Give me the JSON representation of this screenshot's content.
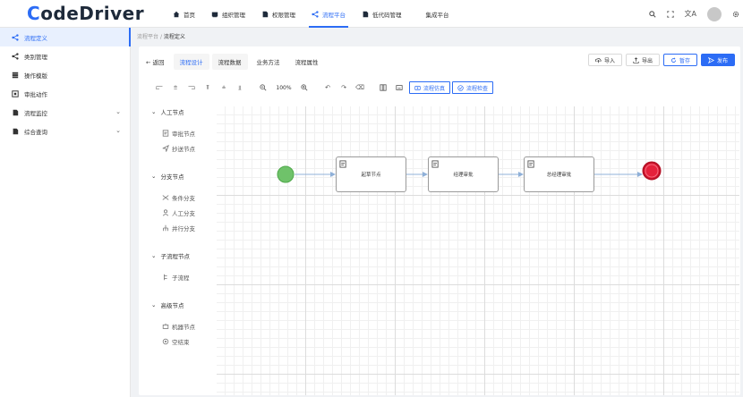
{
  "app": {
    "logo_first": "C",
    "logo_rest": "odeDriver"
  },
  "topnav": [
    {
      "label": "首页",
      "icon": "home-icon"
    },
    {
      "label": "组织管理",
      "icon": "org-icon"
    },
    {
      "label": "权限管理",
      "icon": "permission-icon"
    },
    {
      "label": "流程平台",
      "icon": "workflow-icon",
      "active": true
    },
    {
      "label": "低代码管理",
      "icon": "lowcode-icon"
    },
    {
      "label": "集成平台",
      "icon": ""
    }
  ],
  "sidebar": {
    "items": [
      {
        "label": "流程定义",
        "icon": "flow-define-icon",
        "active": true
      },
      {
        "label": "类别管理",
        "icon": "category-icon"
      },
      {
        "label": "操作模版",
        "icon": "template-icon"
      },
      {
        "label": "审批动作",
        "icon": "approve-action-icon"
      },
      {
        "label": "流程监控",
        "icon": "monitor-icon",
        "expandable": true
      },
      {
        "label": "综合查询",
        "icon": "query-icon",
        "expandable": true
      }
    ]
  },
  "breadcrumb": {
    "root": "流程平台",
    "sep": "/",
    "current": "流程定义"
  },
  "tabs": {
    "back": "← 返回",
    "items": [
      "流程设计",
      "流程数据",
      "业务方法",
      "流程属性"
    ],
    "active": "流程设计"
  },
  "actions": {
    "import": "导入",
    "export": "导出",
    "save": "暂存",
    "publish": "发布"
  },
  "toolbar": {
    "zoom": "100%",
    "simulate": "流程仿真",
    "check": "流程检查"
  },
  "palette": {
    "groups": [
      {
        "title": "人工节点",
        "items": [
          {
            "label": "审批节点",
            "icon": "approve-node-icon"
          },
          {
            "label": "抄送节点",
            "icon": "cc-node-icon"
          }
        ]
      },
      {
        "title": "分支节点",
        "items": [
          {
            "label": "条件分支",
            "icon": "condition-branch-icon"
          },
          {
            "label": "人工分支",
            "icon": "manual-branch-icon"
          },
          {
            "label": "并行分支",
            "icon": "parallel-branch-icon"
          }
        ]
      },
      {
        "title": "子流程节点",
        "items": [
          {
            "label": "子流程",
            "icon": "subprocess-icon"
          }
        ]
      },
      {
        "title": "高级节点",
        "items": [
          {
            "label": "机器节点",
            "icon": "robot-node-icon"
          },
          {
            "label": "空结束",
            "icon": "empty-end-icon"
          }
        ]
      }
    ]
  },
  "diagram": {
    "nodes": [
      {
        "label": "起草节点"
      },
      {
        "label": "经理审批"
      },
      {
        "label": "总经理审批"
      }
    ],
    "colors": {
      "start": "#6fc26a",
      "end": "#e5213b",
      "edge": "#8fb0d8",
      "node_border": "#9a9a9a"
    }
  },
  "colors": {
    "primary": "#2c6cf5"
  }
}
